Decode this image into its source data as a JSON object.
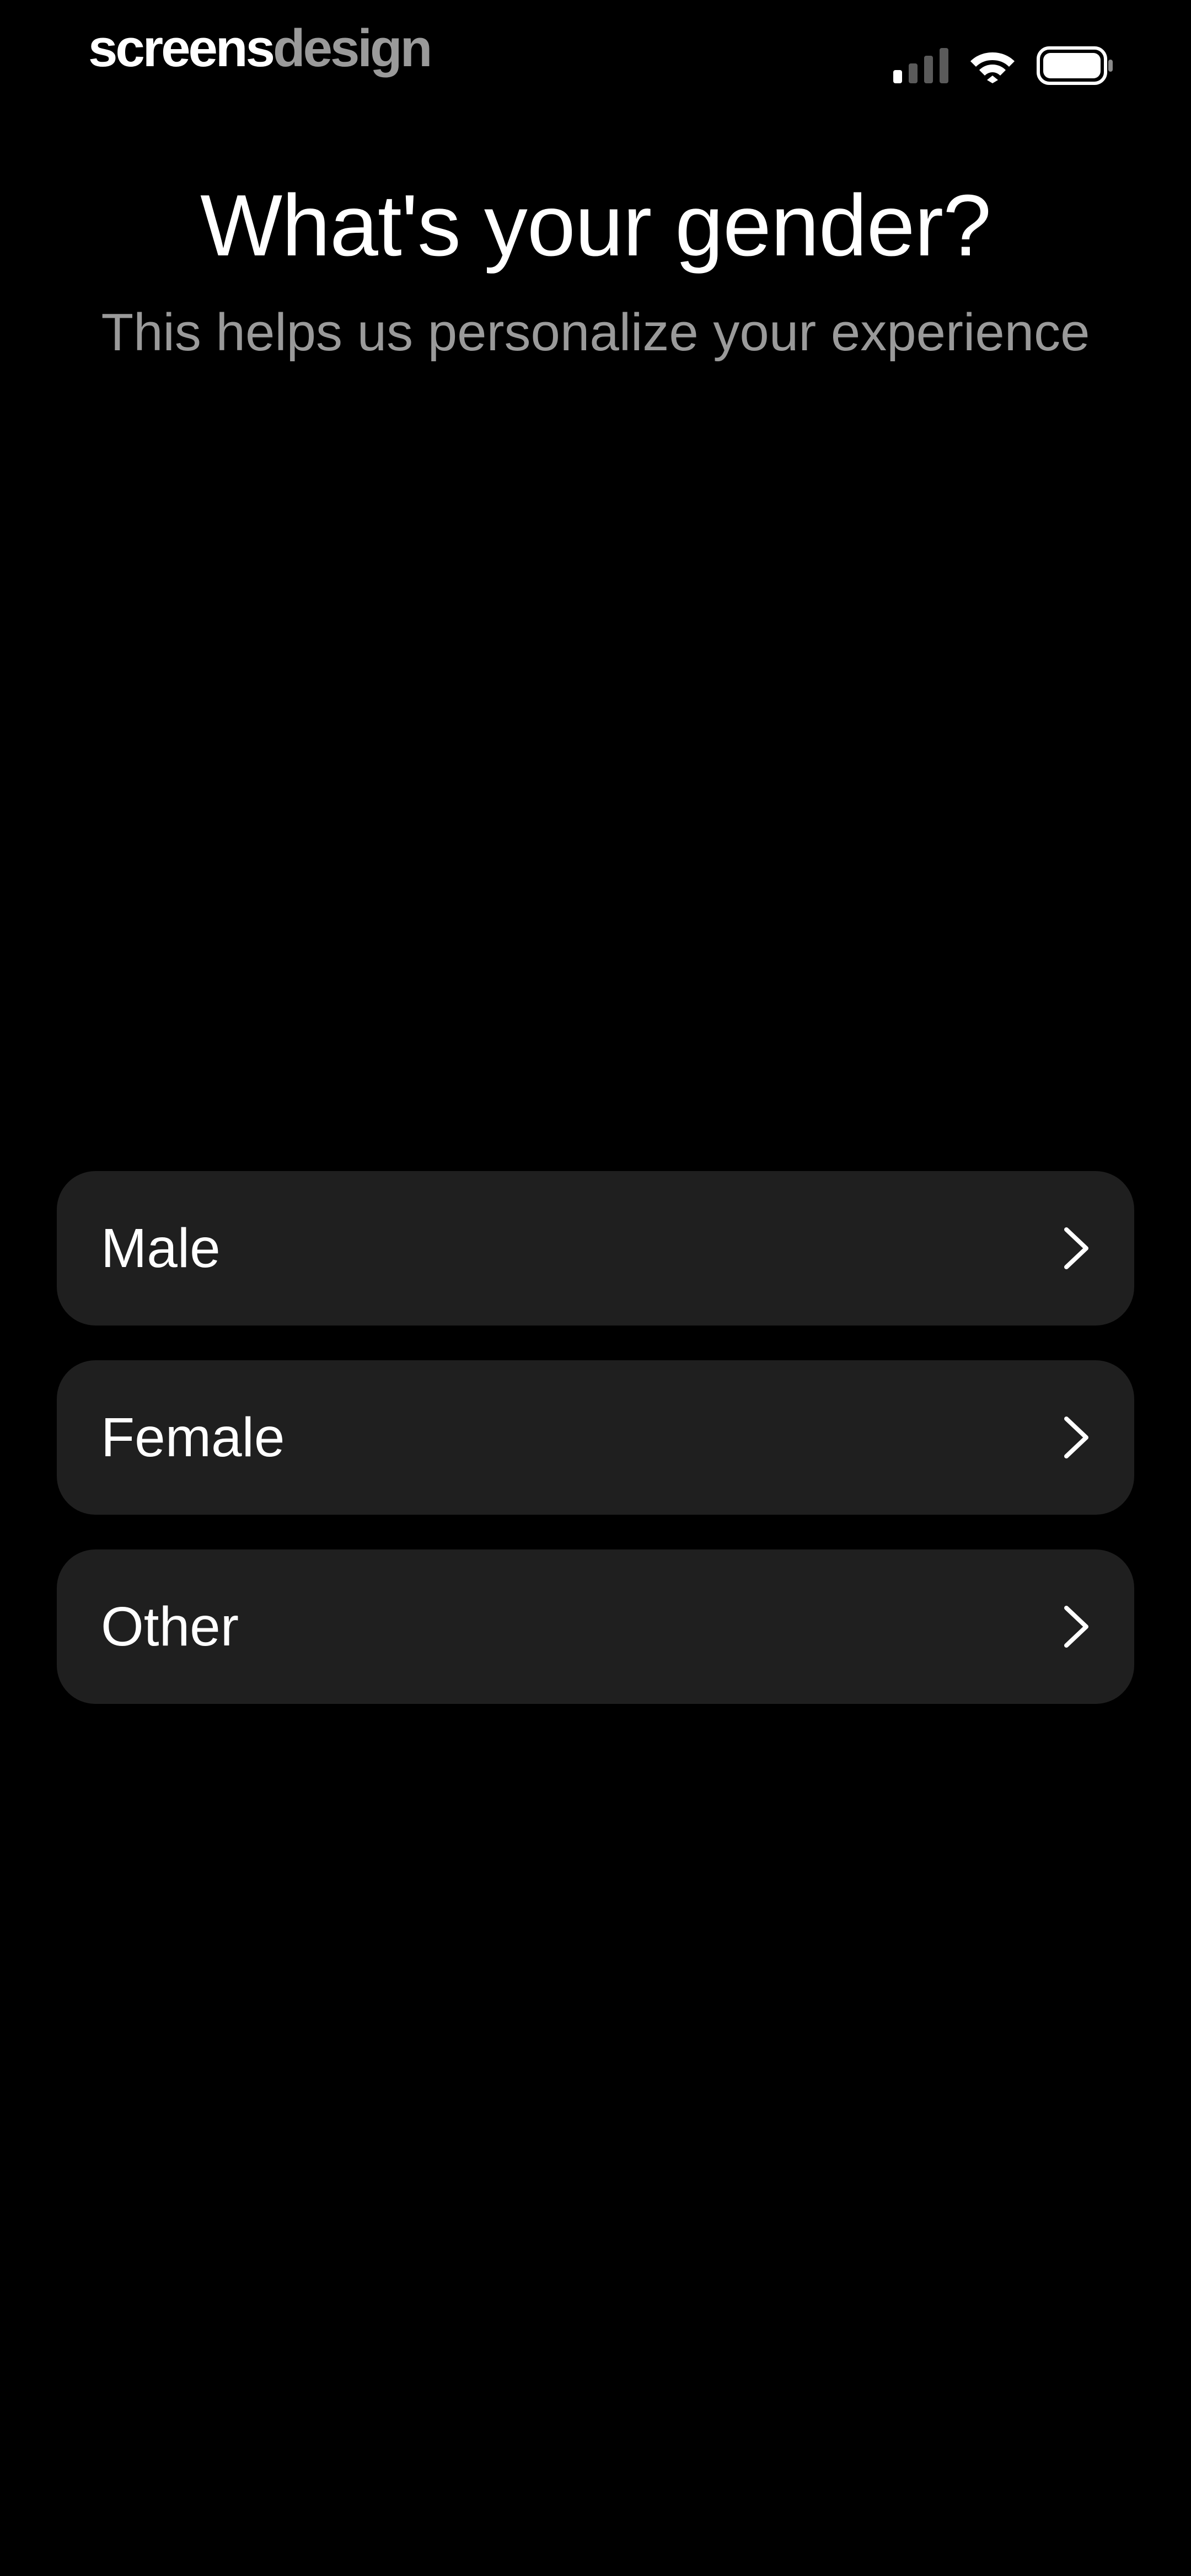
{
  "status_bar": {
    "brand_part1": "screens",
    "brand_part2": "design",
    "icons": [
      "cellular-signal-icon",
      "wifi-icon",
      "battery-icon"
    ]
  },
  "header": {
    "title": "What's your gender?",
    "subtitle": "This helps us personalize your experience"
  },
  "options": [
    {
      "label": "Male",
      "icon": "chevron-right-icon"
    },
    {
      "label": "Female",
      "icon": "chevron-right-icon"
    },
    {
      "label": "Other",
      "icon": "chevron-right-icon"
    }
  ],
  "colors": {
    "background": "#000000",
    "card": "#1f1f1f",
    "text_primary": "#ffffff",
    "text_secondary": "#9a9a9a"
  }
}
